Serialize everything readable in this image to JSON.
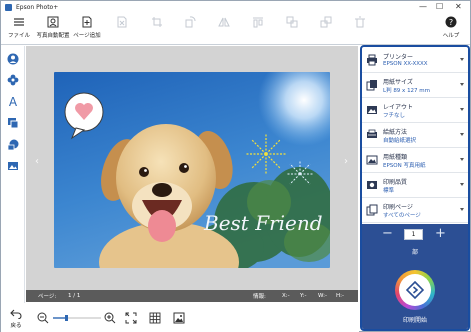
{
  "window": {
    "title": "Epson Photo+",
    "controls": {
      "minimize": "—",
      "maximize": "☐",
      "close": "✕"
    }
  },
  "toolbar": {
    "file": "ファイル",
    "auto_layout": "写真自動配置",
    "add_page": "ページ追加",
    "help": "ヘルプ"
  },
  "status": {
    "page_label": "ページ:",
    "page_value": "1 / 1",
    "info_label": "情報:",
    "x_label": "X:-",
    "y_label": "Y:-",
    "w_label": "W:-",
    "h_label": "H:-"
  },
  "bottom": {
    "back_label": "戻る"
  },
  "panel": {
    "settings": [
      {
        "title": "プリンター",
        "value": "EPSON XX-XXXX",
        "icon": "printer-icon"
      },
      {
        "title": "用紙サイズ",
        "value": "L判 89 x 127 mm",
        "icon": "paper-size-icon"
      },
      {
        "title": "レイアウト",
        "value": "フチなし",
        "icon": "layout-icon"
      },
      {
        "title": "給紙方法",
        "value": "自動給紙選択",
        "icon": "paper-feed-icon"
      },
      {
        "title": "用紙種類",
        "value": "EPSON 写真用紙",
        "icon": "paper-type-icon"
      },
      {
        "title": "印刷品質",
        "value": "標準",
        "icon": "print-quality-icon"
      },
      {
        "title": "印刷ページ",
        "value": "すべてのページ",
        "icon": "print-pages-icon"
      }
    ],
    "copies": {
      "minus": "−",
      "plus": "+",
      "value": "1",
      "unit": "部"
    },
    "print_label": "印刷開始"
  },
  "photo": {
    "text": "Best Friend"
  },
  "colors": {
    "accent": "#1a4da0",
    "panel_dark": "#2c4f94",
    "canvas_bg": "#d3d3d3",
    "statusbar": "#5b5b5b"
  }
}
